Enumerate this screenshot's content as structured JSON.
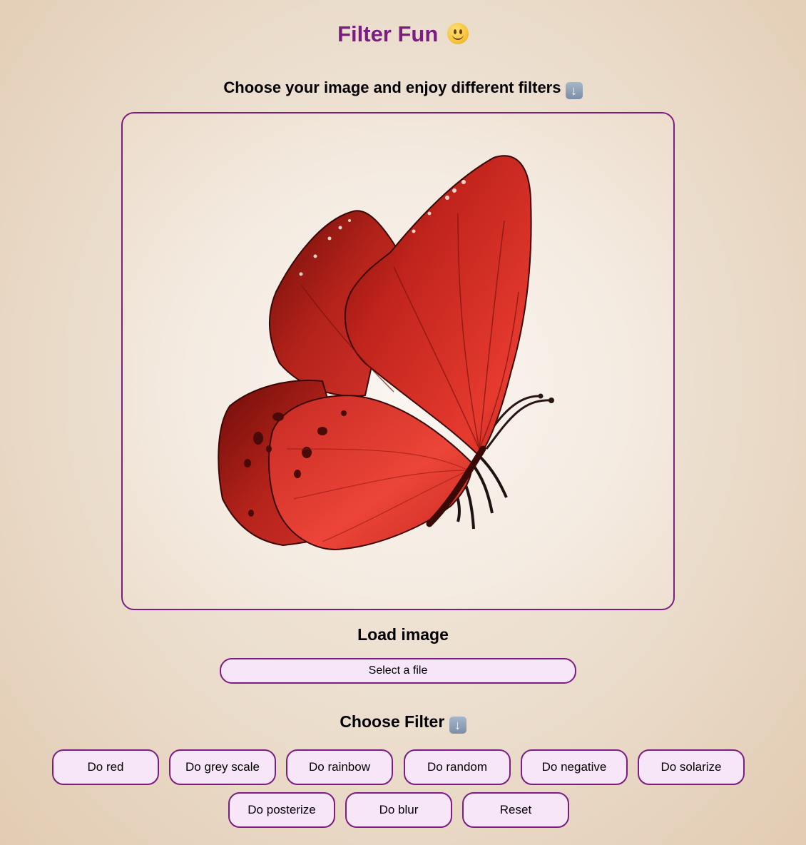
{
  "header": {
    "title": "Filter Fun",
    "title_emoji": "smiley-face-icon",
    "subtitle": "Choose your image and enjoy different filters",
    "subtitle_icon": "down-arrow-icon"
  },
  "image_panel": {
    "content": "red-butterfly-image"
  },
  "load": {
    "heading": "Load image",
    "file_button": "Select a file"
  },
  "filters": {
    "heading": "Choose Filter",
    "heading_icon": "down-arrow-icon",
    "buttons": [
      "Do red",
      "Do grey scale",
      "Do rainbow",
      "Do random",
      "Do negative",
      "Do solarize",
      "Do posterize",
      "Do blur",
      "Reset"
    ]
  },
  "colors": {
    "accent": "#7b1d82",
    "button_bg": "#f6e6f8",
    "page_bg": "#ecdfcf"
  }
}
